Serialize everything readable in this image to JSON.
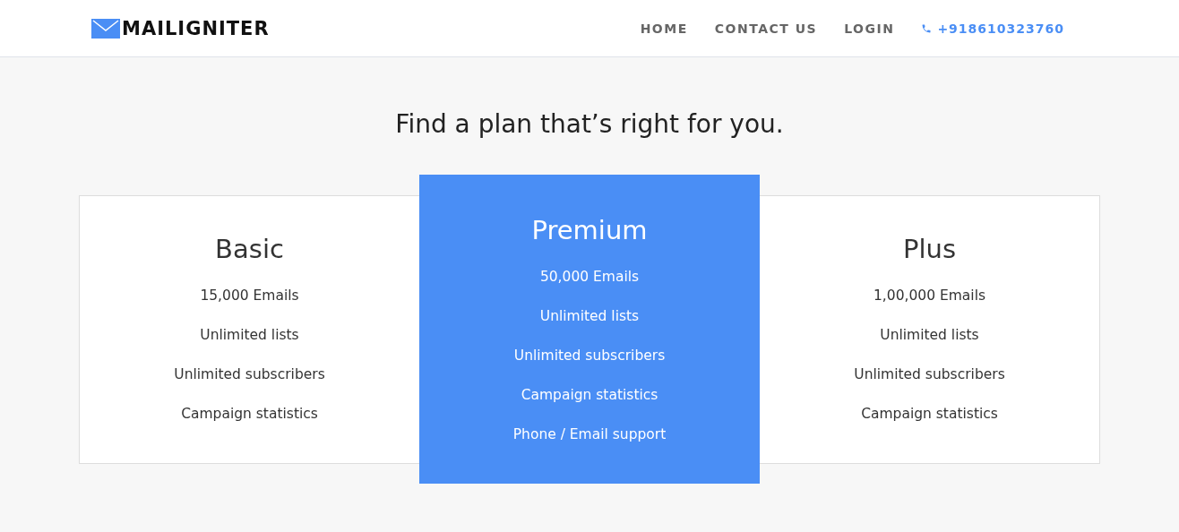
{
  "header": {
    "logo": "MAILIGNITER",
    "nav": [
      {
        "label": "HOME",
        "kind": "link"
      },
      {
        "label": "CONTACT US",
        "kind": "link"
      },
      {
        "label": "LOGIN",
        "kind": "link"
      },
      {
        "label": "+918610323760",
        "kind": "phone"
      }
    ]
  },
  "heading": "Find a plan that’s right for you.",
  "plans": [
    {
      "name": "Basic",
      "featured": false,
      "features": [
        "15,000 Emails",
        "Unlimited lists",
        "Unlimited subscribers",
        "Campaign statistics"
      ]
    },
    {
      "name": "Premium",
      "featured": true,
      "features": [
        "50,000 Emails",
        "Unlimited lists",
        "Unlimited subscribers",
        "Campaign statistics",
        "Phone / Email support"
      ]
    },
    {
      "name": "Plus",
      "featured": false,
      "features": [
        "1,00,000 Emails",
        "Unlimited lists",
        "Unlimited subscribers",
        "Campaign statistics"
      ]
    }
  ]
}
